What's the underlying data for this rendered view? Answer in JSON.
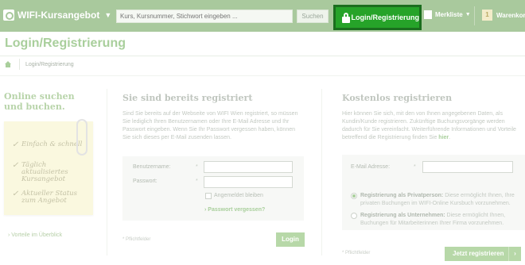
{
  "header": {
    "brand": "WIFI-Kursangebot",
    "search_placeholder": "Kurs, Kursnummer, Stichwort eingeben ...",
    "search_button": "Suchen",
    "login_tab": "Login/Registrierung",
    "merkliste": "Merkliste",
    "cart_count": "1",
    "cart_label": "Warenkorb"
  },
  "page": {
    "title": "Login/Registrierung",
    "breadcrumb_current": "Login/Registrierung"
  },
  "promo": {
    "headline": "Online suchen und buchen.",
    "items": [
      "Einfach & schnell",
      "Täglich aktualisiertes Kursangebot",
      "Aktueller Status zum Angebot"
    ],
    "link": "› Vorteile im Überblick"
  },
  "login": {
    "heading": "Sie sind bereits registriert",
    "description": "Sind Sie bereits auf der Webseite von WIFI Wien registriert, so müssen Sie lediglich Ihren Benutzernamen oder Ihre E-Mail Adresse und Ihr Passwort eingeben. Wenn Sie Ihr Passwort vergessen haben, können Sie sich dieses per E-Mail zusenden lassen.",
    "username_label": "Benutzername:",
    "password_label": "Passwort:",
    "required_star": "*",
    "remember_label": "Angemeldet bleiben",
    "forgot_link": "› Passwort vergessen?",
    "required_note": "* Pflichtfelder",
    "login_button": "Login"
  },
  "register": {
    "heading": "Kostenlos registrieren",
    "description": "Hier können Sie sich, mit den von Ihnen angegebenen Daten, als Kundin/Kunde registrieren. Zukünftige Buchungsvorgänge werden dadurch für Sie vereinfacht. Weiterführende Informationen und Vorteile betreffend die Registrierung finden Sie",
    "description_link": "hier",
    "email_label": "E-Mail Adresse:",
    "options": [
      {
        "title": "Registrierung als Privatperson:",
        "text": " Diese ermöglicht Ihnen, Ihre privaten Buchungen im WIFI-Online Kursbuch vorzunehmen.",
        "selected": true
      },
      {
        "title": "Registrierung als Unternehmen:",
        "text": " Diese ermöglicht Ihnen, Buchungen für Mitarbeiterinnen Ihrer Firma vorzunehmen.",
        "selected": false
      }
    ],
    "required_note": "* Pflichtfelder",
    "register_button": "Jetzt registrieren",
    "arrow": "›"
  }
}
